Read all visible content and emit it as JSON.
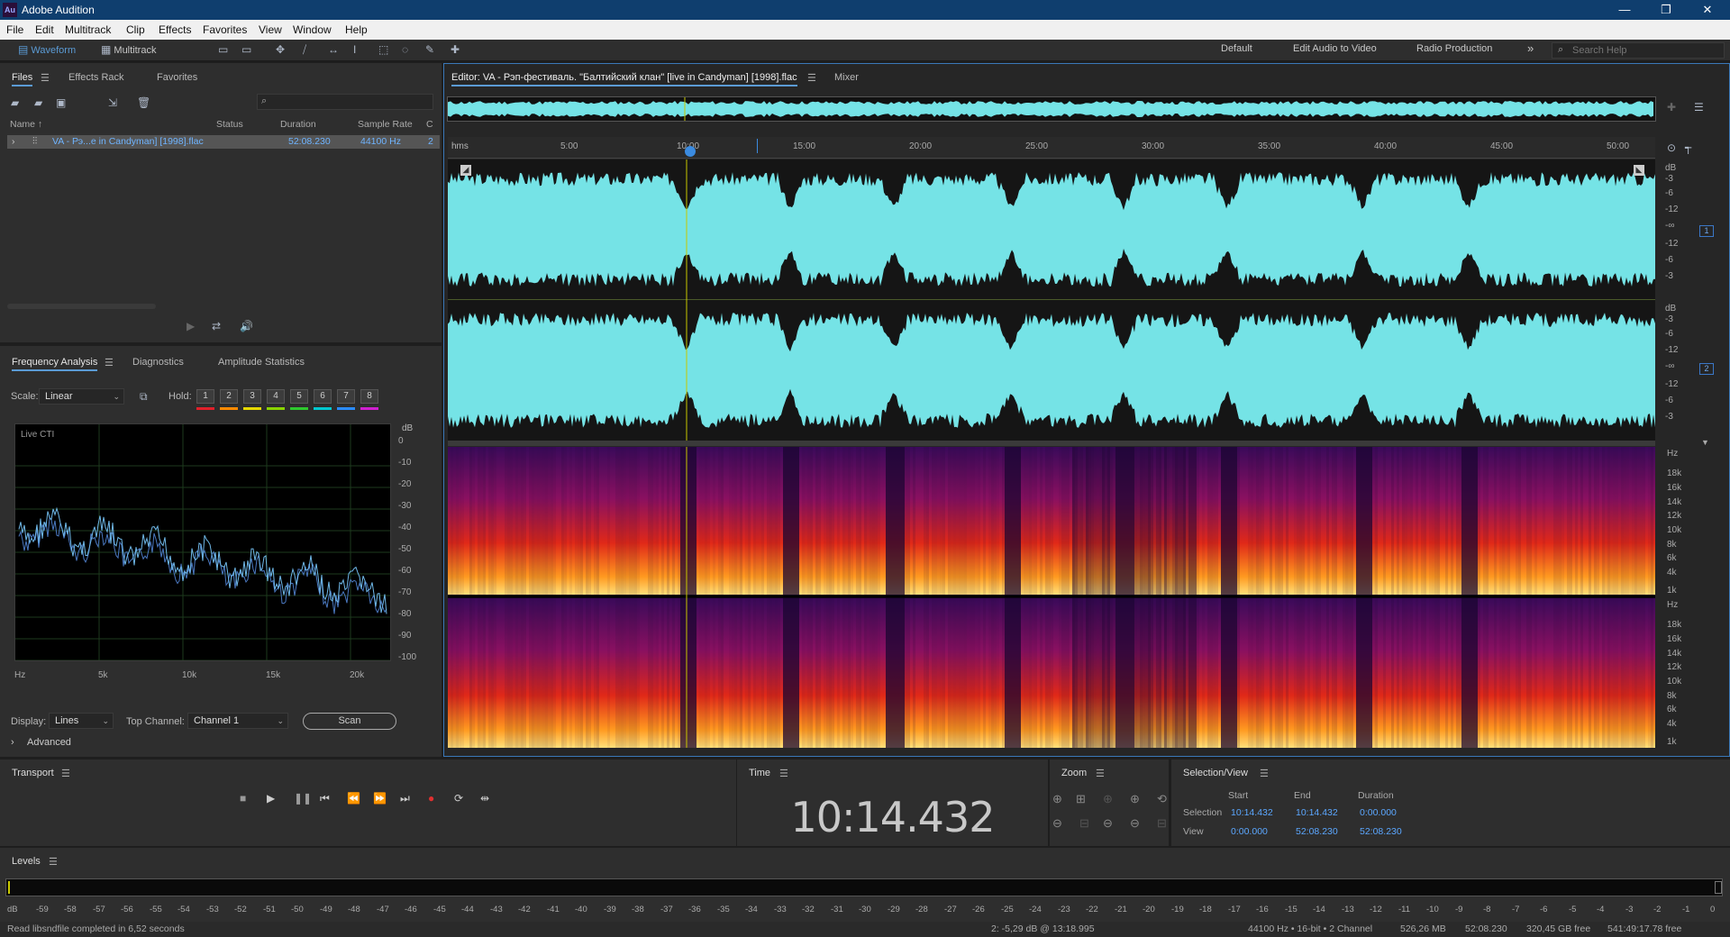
{
  "app": {
    "title": "Adobe Audition",
    "logo": "Au"
  },
  "menu": [
    "File",
    "Edit",
    "Multitrack",
    "Clip",
    "Effects",
    "Favorites",
    "View",
    "Window",
    "Help"
  ],
  "toolbar": {
    "waveform_label": "Waveform",
    "multitrack_label": "Multitrack",
    "workspaces": [
      "Default",
      "Edit Audio to Video",
      "Radio Production"
    ],
    "more": "»",
    "search_placeholder": "Search Help"
  },
  "files_panel": {
    "tabs": [
      "Files",
      "Effects Rack",
      "Favorites"
    ],
    "search_value": "",
    "columns": [
      "Name ↑",
      "Status",
      "Duration",
      "Sample Rate",
      "C"
    ],
    "rows": [
      {
        "name": "VA - Рэ...e in Candyman] [1998].flac",
        "status": "",
        "duration": "52:08.230",
        "sample_rate": "44100 Hz",
        "channels": "2"
      }
    ]
  },
  "freq_panel": {
    "tabs": [
      "Frequency Analysis",
      "Diagnostics",
      "Amplitude Statistics"
    ],
    "scale_label": "Scale:",
    "scale_value": "Linear",
    "hold_label": "Hold:",
    "holds": [
      "1",
      "2",
      "3",
      "4",
      "5",
      "6",
      "7",
      "8"
    ],
    "hold_colors": [
      "#e0202a",
      "#ff8a00",
      "#e6d800",
      "#8ad400",
      "#2ec82e",
      "#00c8d0",
      "#2a8cff",
      "#d020d0"
    ],
    "graph_label": "Live CTI",
    "db_unit": "dB",
    "db_ticks": [
      "0",
      "-10",
      "-20",
      "-30",
      "-40",
      "-50",
      "-60",
      "-70",
      "-80",
      "-90",
      "-100"
    ],
    "x_ticks": [
      "Hz",
      "5k",
      "10k",
      "15k",
      "20k"
    ],
    "display_label": "Display:",
    "display_value": "Lines",
    "top_channel_label": "Top Channel:",
    "top_channel_value": "Channel 1",
    "scan_label": "Scan",
    "advanced_label": "Advanced"
  },
  "editor": {
    "tab_label": "Editor: VA - Рэп-фестиваль. \"Балтийский клан\" [live in Candyman] [1998].flac",
    "mixer_label": "Mixer",
    "time_unit": "hms",
    "time_ticks": [
      "5:00",
      "10:00",
      "15:00",
      "20:00",
      "25:00",
      "30:00",
      "35:00",
      "40:00",
      "45:00",
      "50:00"
    ],
    "wave_db_ticks": [
      "dB",
      "-3",
      "-6",
      "-12",
      "-∞",
      "-12",
      "-6",
      "-3"
    ],
    "spec_ticks": [
      "Hz",
      "18k",
      "16k",
      "14k",
      "12k",
      "10k",
      "8k",
      "6k",
      "4k",
      "1k"
    ],
    "channel_badges": [
      "1",
      "2"
    ],
    "waveform_color": "#75e3e6"
  },
  "transport": {
    "title": "Transport"
  },
  "time_panel": {
    "title": "Time",
    "value": "10:14.432"
  },
  "zoom_panel": {
    "title": "Zoom"
  },
  "selection_panel": {
    "title": "Selection/View",
    "headers": [
      "Start",
      "End",
      "Duration"
    ],
    "selection_label": "Selection",
    "view_label": "View",
    "selection": [
      "10:14.432",
      "10:14.432",
      "0:00.000"
    ],
    "view": [
      "0:00.000",
      "52:08.230",
      "52:08.230"
    ]
  },
  "levels": {
    "title": "Levels",
    "ticks": [
      "dB",
      "-59",
      "-58",
      "-57",
      "-56",
      "-55",
      "-54",
      "-53",
      "-52",
      "-51",
      "-50",
      "-49",
      "-48",
      "-47",
      "-46",
      "-45",
      "-44",
      "-43",
      "-42",
      "-41",
      "-40",
      "-39",
      "-38",
      "-37",
      "-36",
      "-35",
      "-34",
      "-33",
      "-32",
      "-31",
      "-30",
      "-29",
      "-28",
      "-27",
      "-26",
      "-25",
      "-24",
      "-23",
      "-22",
      "-21",
      "-20",
      "-19",
      "-18",
      "-17",
      "-16",
      "-15",
      "-14",
      "-13",
      "-12",
      "-11",
      "-10",
      "-9",
      "-8",
      "-7",
      "-6",
      "-5",
      "-4",
      "-3",
      "-2",
      "-1",
      "0"
    ]
  },
  "status": {
    "message": "Read libsndfile completed in 6,52 seconds",
    "cursor": "2: -5,29 dB @ 13:18.995",
    "format": "44100 Hz • 16-bit • 2 Channel",
    "size": "526,26 MB",
    "duration": "52:08.230",
    "free": "320,45 GB free",
    "free_time": "541:49:17.78 free"
  }
}
